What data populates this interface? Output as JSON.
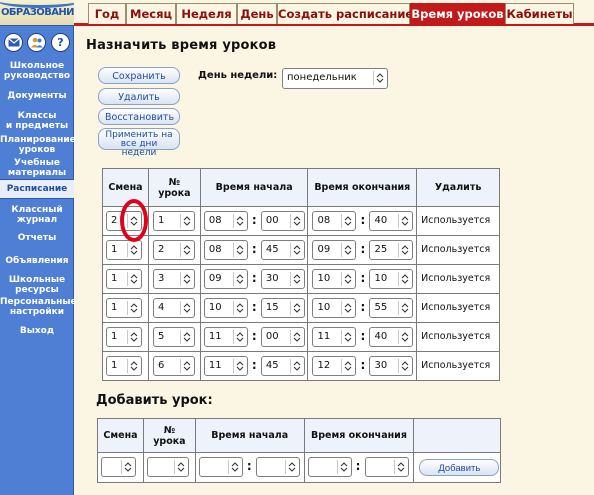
{
  "logo": {
    "text": "ОБРАЗОВАНИ"
  },
  "sidebar": {
    "icons": [
      "mail-icon",
      "users-icon",
      "help-icon"
    ],
    "help_glyph": "?",
    "items": [
      {
        "label": "Школьное\nруководство"
      },
      {
        "label": "Документы"
      },
      {
        "label": "Классы\nи предметы"
      },
      {
        "label": "Планирование\nуроков"
      },
      {
        "label": "Учебные\nматериалы"
      },
      {
        "label": "Расписание",
        "active": true
      },
      {
        "label": "Классный\nжурнал"
      },
      {
        "label": "Отчеты"
      },
      {
        "label": "Объявления"
      },
      {
        "label": "Школьные\nресурсы"
      },
      {
        "label": "Персональные\nнастройки"
      },
      {
        "label": "Выход"
      }
    ]
  },
  "tabs": [
    {
      "label": "Год"
    },
    {
      "label": "Месяц"
    },
    {
      "label": "Неделя"
    },
    {
      "label": "День"
    },
    {
      "label": "Создать расписание"
    },
    {
      "label": "Время уроков",
      "active": true
    },
    {
      "label": "Кабинеты"
    }
  ],
  "page": {
    "title": "Назначить время уроков",
    "actions": {
      "save": "Сохранить",
      "delete": "Удалить",
      "restore": "Восстановить",
      "apply_all": "Применить на\nвсе дни недели"
    },
    "day_label": "День недели:",
    "day_value": "понедельник"
  },
  "lessons_table": {
    "headers": {
      "shift": "Смена",
      "lesson_no": "№\nурока",
      "start": "Время начала",
      "end": "Время окончания",
      "delete": "Удалить"
    },
    "colon": ":",
    "rows": [
      {
        "shift": "2",
        "lesson": "1",
        "start_h": "08",
        "start_m": "00",
        "end_h": "08",
        "end_m": "40",
        "status": "Используется"
      },
      {
        "shift": "1",
        "lesson": "2",
        "start_h": "08",
        "start_m": "45",
        "end_h": "09",
        "end_m": "25",
        "status": "Используется"
      },
      {
        "shift": "1",
        "lesson": "3",
        "start_h": "09",
        "start_m": "30",
        "end_h": "10",
        "end_m": "10",
        "status": "Используется"
      },
      {
        "shift": "1",
        "lesson": "4",
        "start_h": "10",
        "start_m": "15",
        "end_h": "10",
        "end_m": "55",
        "status": "Используется"
      },
      {
        "shift": "1",
        "lesson": "5",
        "start_h": "11",
        "start_m": "00",
        "end_h": "11",
        "end_m": "40",
        "status": "Используется"
      },
      {
        "shift": "1",
        "lesson": "6",
        "start_h": "11",
        "start_m": "45",
        "end_h": "12",
        "end_m": "30",
        "status": "Используется"
      }
    ]
  },
  "add_section": {
    "title": "Добавить урок:",
    "button": "Добавить"
  },
  "colors": {
    "sidebar": "#4f7fd4",
    "tab_accent": "#c21a1a",
    "highlight": "#e1001a"
  }
}
